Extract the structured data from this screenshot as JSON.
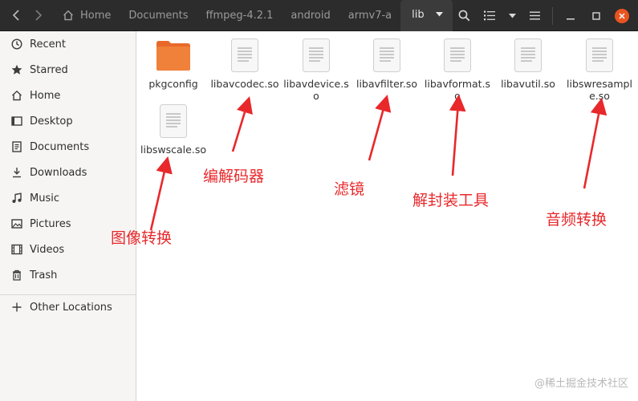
{
  "header": {
    "breadcrumbs": [
      "Home",
      "Documents",
      "ffmpeg-4.2.1",
      "android",
      "armv7-a",
      "lib"
    ]
  },
  "sidebar": {
    "items": [
      {
        "label": "Recent",
        "icon": "clock-icon"
      },
      {
        "label": "Starred",
        "icon": "star-icon"
      },
      {
        "label": "Home",
        "icon": "home-icon"
      },
      {
        "label": "Desktop",
        "icon": "desktop-icon"
      },
      {
        "label": "Documents",
        "icon": "document-icon"
      },
      {
        "label": "Downloads",
        "icon": "download-icon"
      },
      {
        "label": "Music",
        "icon": "music-icon"
      },
      {
        "label": "Pictures",
        "icon": "picture-icon"
      },
      {
        "label": "Videos",
        "icon": "video-icon"
      },
      {
        "label": "Trash",
        "icon": "trash-icon"
      }
    ],
    "other_locations": "Other Locations"
  },
  "files": [
    {
      "name": "pkgconfig",
      "type": "folder"
    },
    {
      "name": "libavcodec.so",
      "type": "file"
    },
    {
      "name": "libavdevice.so",
      "type": "file"
    },
    {
      "name": "libavfilter.so",
      "type": "file"
    },
    {
      "name": "libavformat.so",
      "type": "file"
    },
    {
      "name": "libavutil.so",
      "type": "file"
    },
    {
      "name": "libswresample.so",
      "type": "file"
    },
    {
      "name": "libswscale.so",
      "type": "file"
    }
  ],
  "annotations": {
    "codec": "编解码器",
    "filter": "滤镜",
    "format": "解封装工具",
    "resample": "音频转换",
    "scale": "图像转换"
  },
  "watermark": "@稀土掘金技术社区",
  "colors": {
    "accent": "#e95420",
    "annotation": "#e8282b",
    "folder": "#f0813a"
  }
}
